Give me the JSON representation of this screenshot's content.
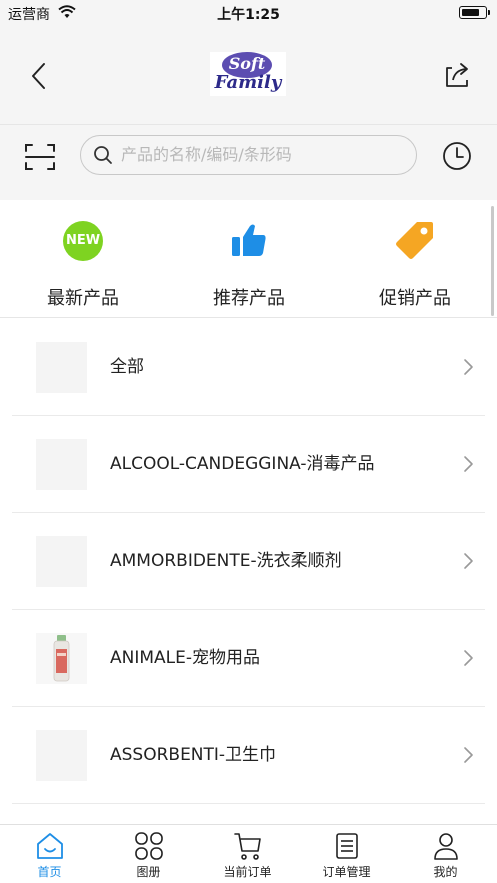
{
  "status_bar": {
    "carrier": "运营商",
    "time": "上午1:25"
  },
  "header": {
    "logo_top": "Soft",
    "logo_bottom": "Family",
    "back_icon": "chevron-left-icon",
    "share_icon": "share-icon"
  },
  "search": {
    "placeholder": "产品的名称/编码/条形码",
    "scan_icon": "scan-icon",
    "history_icon": "clock-icon"
  },
  "quick_links": [
    {
      "label": "最新产品",
      "icon": "new-badge-icon",
      "badge_text": "NEW",
      "color": "#7ed321"
    },
    {
      "label": "推荐产品",
      "icon": "thumbs-up-icon",
      "color": "#1e8ee6"
    },
    {
      "label": "促销产品",
      "icon": "price-tag-icon",
      "color": "#f5a623"
    }
  ],
  "categories": [
    {
      "label": "全部"
    },
    {
      "label": "ALCOOL-CANDEGGINA-消毒产品"
    },
    {
      "label": "AMMORBIDENTE-洗衣柔顺剂"
    },
    {
      "label": "ANIMALE-宠物用品"
    },
    {
      "label": "ASSORBENTI-卫生巾"
    }
  ],
  "tabs": [
    {
      "label": "首页",
      "icon": "home-icon",
      "active": true
    },
    {
      "label": "图册",
      "icon": "grid-icon",
      "active": false
    },
    {
      "label": "当前订单",
      "icon": "cart-icon",
      "active": false
    },
    {
      "label": "订单管理",
      "icon": "document-icon",
      "active": false
    },
    {
      "label": "我的",
      "icon": "user-icon",
      "active": false
    }
  ],
  "colors": {
    "accent": "#1e8ee6",
    "new_badge": "#7ed321",
    "tag": "#f5a623",
    "header_bg": "#f5f5f5"
  }
}
